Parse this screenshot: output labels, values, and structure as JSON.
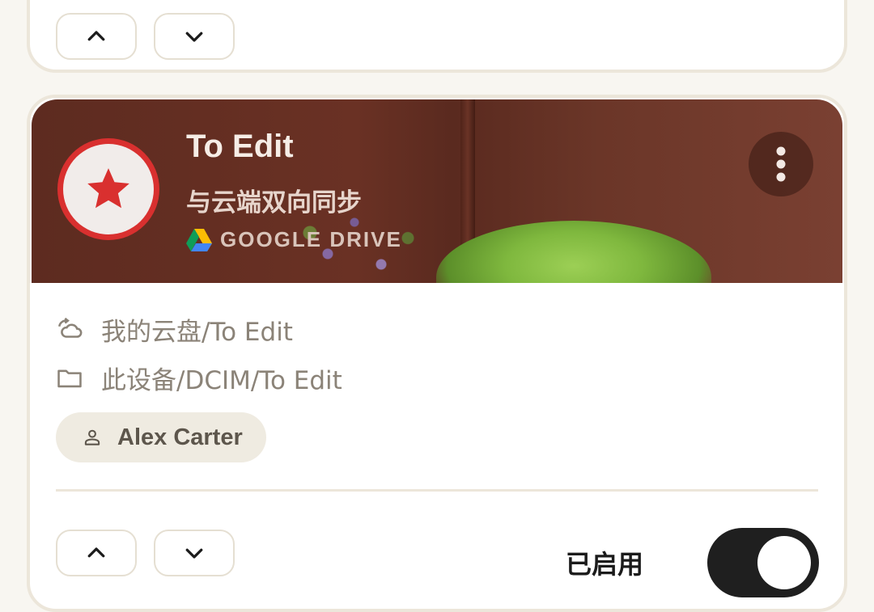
{
  "top_card": {
    "up_icon": "chevron-up-icon",
    "down_icon": "chevron-down-icon"
  },
  "sync_card": {
    "title": "To Edit",
    "subtitle": "与云端双向同步",
    "provider": "GOOGLE DRIVE",
    "provider_icon": "google-drive-icon",
    "avatar_icon": "star-icon",
    "menu_icon": "more-vert-icon",
    "cloud_path": "我的云盘/To Edit",
    "cloud_path_icon": "cloud-sync-icon",
    "local_path": "此设备/DCIM/To Edit",
    "local_path_icon": "folder-icon",
    "account": "Alex Carter",
    "account_icon": "person-icon",
    "enabled_label": "已启用",
    "enabled": true
  },
  "colors": {
    "accent_red": "#d9302f",
    "banner_brown": "#5d2b20",
    "chip_bg": "#efebe1",
    "toggle_on": "#1f1f1f"
  }
}
